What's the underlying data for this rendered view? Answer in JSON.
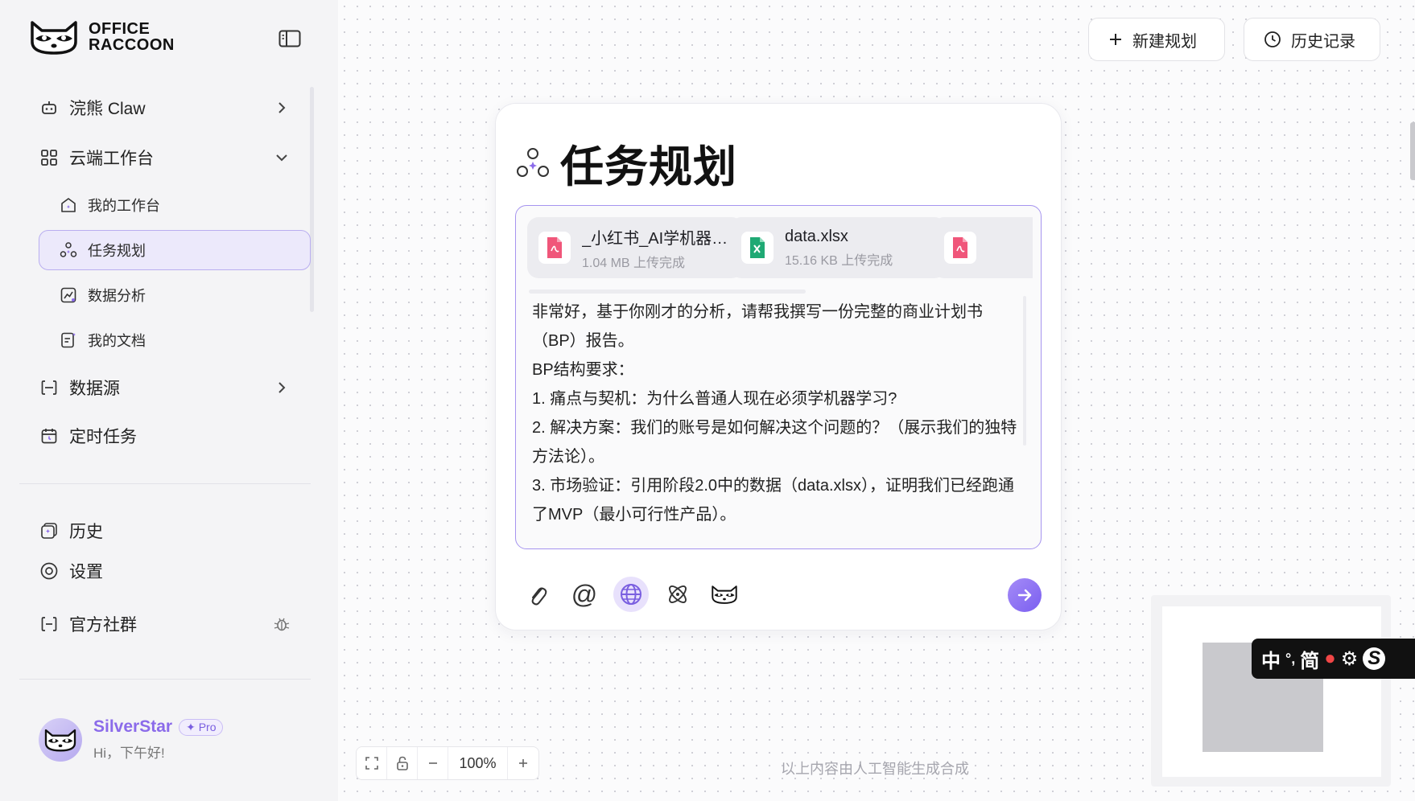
{
  "app": {
    "brand_line1": "OFFICE",
    "brand_line2": "RACCOON"
  },
  "sidebar": {
    "items": [
      {
        "label": "浣熊 Claw"
      },
      {
        "label": "云端工作台"
      },
      {
        "label": "数据源"
      },
      {
        "label": "定时任务"
      }
    ],
    "sub_items": [
      {
        "label": "我的工作台"
      },
      {
        "label": "任务规划"
      },
      {
        "label": "数据分析"
      },
      {
        "label": "我的文档"
      }
    ],
    "bottom": [
      {
        "label": "历史"
      },
      {
        "label": "设置"
      },
      {
        "label": "官方社群"
      }
    ]
  },
  "user": {
    "name": "SilverStar",
    "badge": "Pro",
    "greeting": "Hi，下午好!"
  },
  "header": {
    "new_plan": "新建规划",
    "history": "历史记录"
  },
  "card": {
    "title": "任务规划",
    "files": [
      {
        "name": "_小红书_AI学机器学习...",
        "status": "1.04 MB 上传完成",
        "type": "pdf"
      },
      {
        "name": "data.xlsx",
        "status": "15.16 KB 上传完成",
        "type": "xlsx"
      },
      {
        "name": "",
        "status": "",
        "type": "pdf"
      }
    ],
    "prompt": "非常好，基于你刚才的分析，请帮我撰写一份完整的商业计划书（BP）报告。\nBP结构要求：\n1. 痛点与契机：为什么普通人现在必须学机器学习?\n2. 解决方案：我们的账号是如何解决这个问题的？（展示我们的独特方法论）。\n3. 市场验证：引用阶段2.0中的数据（data.xlsx），证明我们已经跑通了MVP（最小可行性产品）。"
  },
  "zoom": {
    "level": "100%"
  },
  "footer": {
    "disclaimer": "以上内容由人工智能生成合成"
  },
  "ime": {
    "text1": "中",
    "text2": "简"
  },
  "colors": {
    "accent": "#8b6bea",
    "pdf": "#f0567a",
    "xlsx": "#1fa974"
  }
}
